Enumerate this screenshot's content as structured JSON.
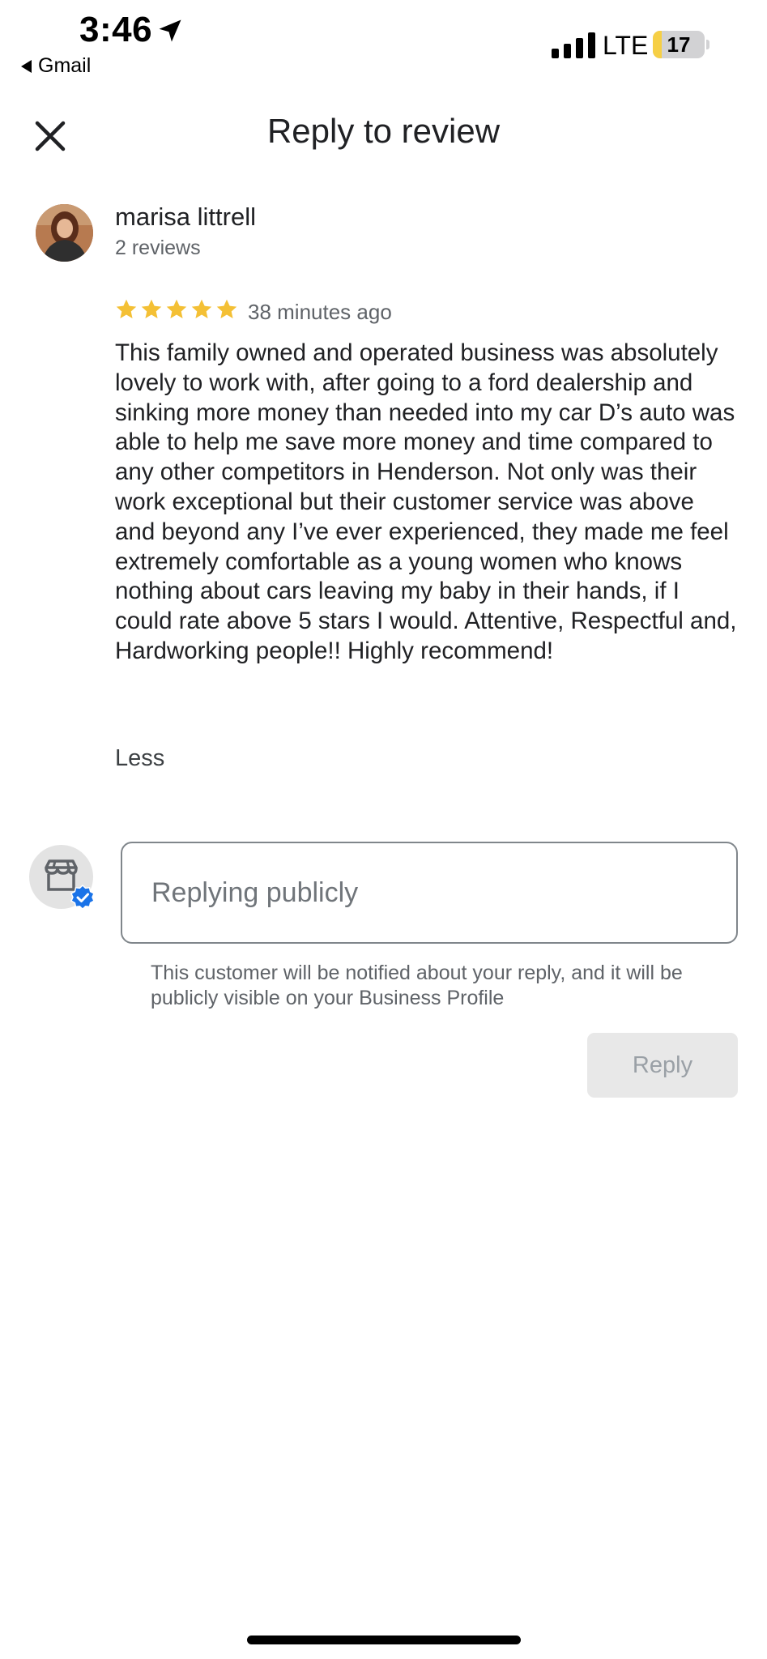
{
  "status_bar": {
    "time": "3:46",
    "back_app": "Gmail",
    "network": "LTE",
    "battery": "17",
    "battery_level_pct": 17,
    "icons": [
      "location-arrow-icon",
      "cellular-signal-icon",
      "battery-icon"
    ]
  },
  "header": {
    "title": "Reply to review",
    "close_icon": "close-icon"
  },
  "review": {
    "reviewer_name": "marisa littrell",
    "reviewer_count": "2 reviews",
    "rating": 5,
    "rating_max": 5,
    "time_ago": "38 minutes ago",
    "body": "This family owned and operated business was absolutely lovely to work with, after going to a ford dealership and sinking more money than needed into my car D’s auto was able to help me save more money and time compared to any other competitors in Henderson. Not only was their work exceptional but their customer service was above and beyond any I’ve ever experienced, they made me feel extremely comfortable as a young women who knows nothing about cars leaving my baby in their hands, if I could rate above 5 stars I would. Attentive, Respectful and, Hardworking people!! Highly recommend!",
    "less_label": "Less",
    "star_color": "#f4c035"
  },
  "reply": {
    "placeholder": "Replying publicly",
    "value": "",
    "notice": "This customer will be notified about your reply, and it will be publicly visible on your Business Profile",
    "button_label": "Reply",
    "button_enabled": false,
    "business_icon": "storefront-icon",
    "verified_icon": "verified-badge-icon",
    "verified_color": "#1a73e8"
  }
}
